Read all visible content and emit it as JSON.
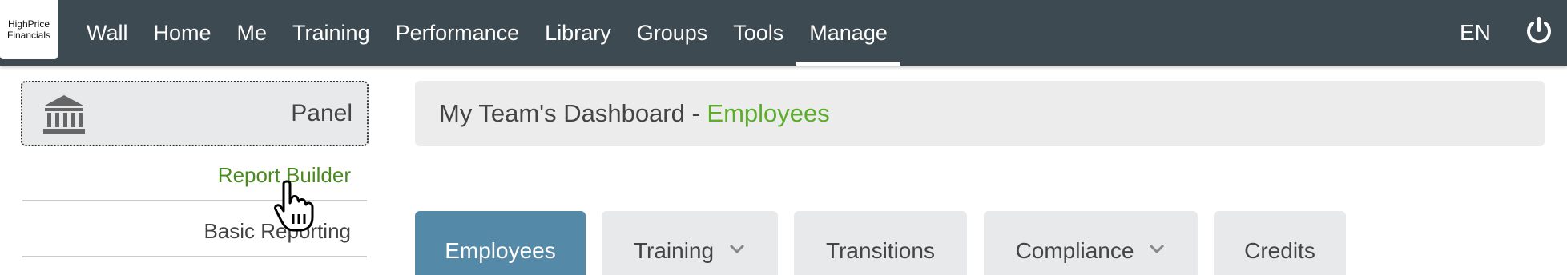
{
  "logo": {
    "line1": "HighPrice",
    "line2": "Financials"
  },
  "nav": {
    "items": [
      {
        "label": "Wall"
      },
      {
        "label": "Home"
      },
      {
        "label": "Me"
      },
      {
        "label": "Training"
      },
      {
        "label": "Performance"
      },
      {
        "label": "Library"
      },
      {
        "label": "Groups"
      },
      {
        "label": "Tools"
      },
      {
        "label": "Manage",
        "active": true
      }
    ],
    "language": "EN",
    "power_icon": "power-icon"
  },
  "sidebar": {
    "panel_label": "Panel",
    "panel_icon": "bank-icon",
    "links": [
      {
        "label": "Report Builder"
      },
      {
        "label": "Basic Reporting"
      }
    ]
  },
  "header": {
    "title": "My Team's Dashboard - ",
    "accent": "Employees"
  },
  "tabs": [
    {
      "label": "Employees",
      "active": true,
      "dropdown": false
    },
    {
      "label": "Training",
      "dropdown": true
    },
    {
      "label": "Transitions",
      "dropdown": false
    },
    {
      "label": "Compliance",
      "dropdown": true
    },
    {
      "label": "Credits",
      "dropdown": false
    }
  ],
  "colors": {
    "topbar": "#3d4a52",
    "accent_green": "#5cad2a",
    "link_green": "#4a8a1f",
    "active_tab": "#5589a8"
  }
}
